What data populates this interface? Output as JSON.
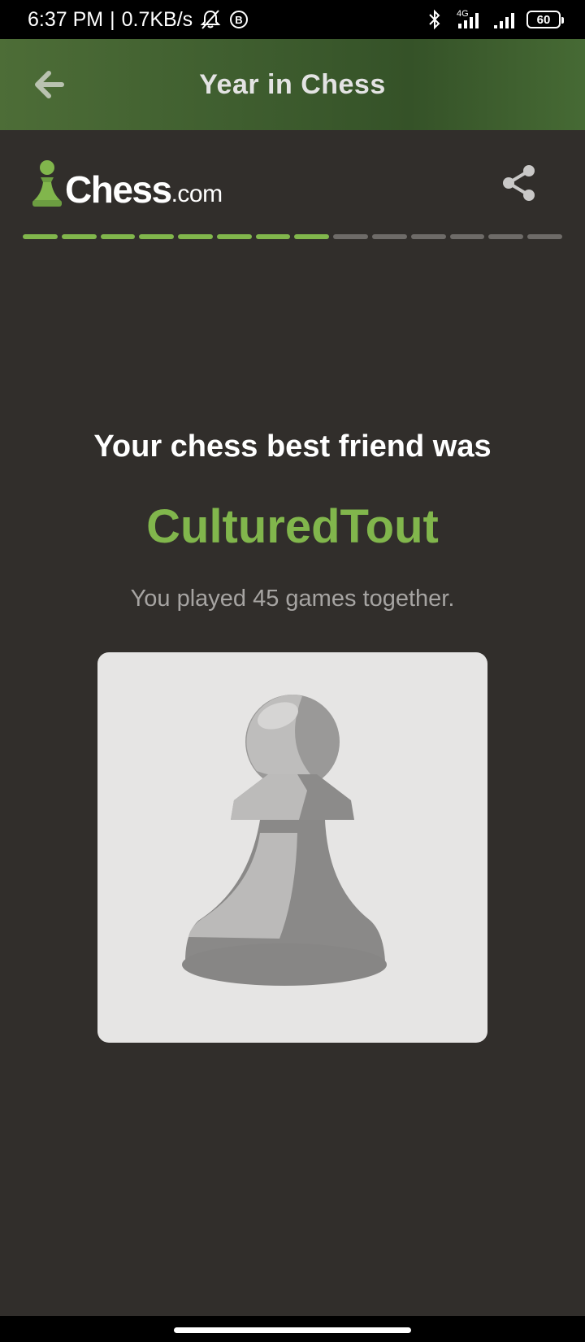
{
  "status_bar": {
    "time": "6:37 PM",
    "separator": "|",
    "speed": "0.7KB/s",
    "network": "4G",
    "battery": "60",
    "icons": [
      "mute-icon",
      "b-icon",
      "bluetooth-icon",
      "signal-icon",
      "signal-icon",
      "battery-icon"
    ]
  },
  "app_bar": {
    "title": "Year in Chess",
    "back_icon": "arrow-left-icon"
  },
  "logo": {
    "brand": "Chess",
    "suffix": ".com",
    "icon": "pawn-icon"
  },
  "share_icon": "share-icon",
  "progress": {
    "total_steps": 14,
    "completed_steps": 8,
    "done_color": "#81b64c",
    "pending_color": "#6e6b68"
  },
  "content": {
    "heading": "Your chess best friend was",
    "friend_name": "CulturedTout",
    "games_text": "You played 45 games together.",
    "avatar_icon": "pawn-avatar-icon"
  },
  "colors": {
    "background": "#312e2b",
    "accent": "#81b64c",
    "app_bar": "#3f5e2f"
  }
}
